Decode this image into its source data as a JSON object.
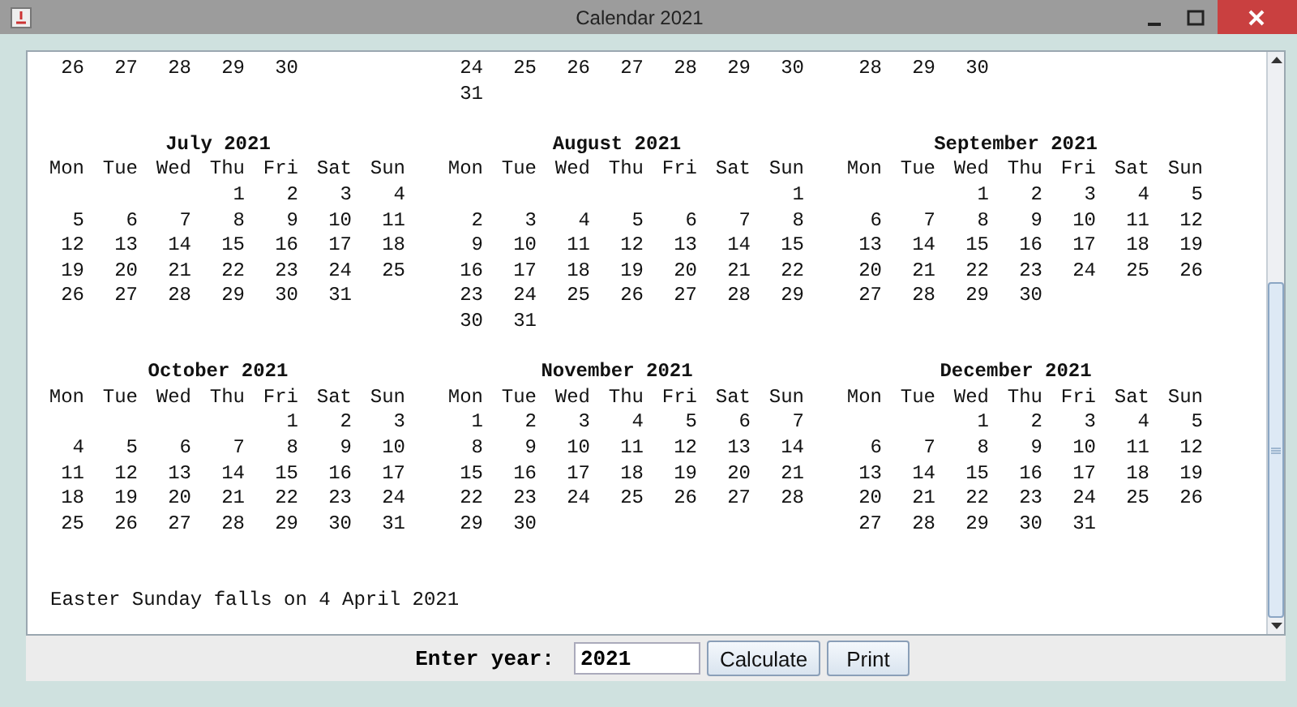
{
  "window": {
    "title": "Calendar 2021"
  },
  "partial_months": [
    {
      "weeks": [
        [
          "26",
          "27",
          "28",
          "29",
          "30"
        ]
      ]
    },
    {
      "weeks": [
        [
          "24",
          "25",
          "26",
          "27",
          "28",
          "29",
          "30"
        ],
        [
          "31"
        ]
      ]
    },
    {
      "weeks": [
        [
          "28",
          "29",
          "30"
        ]
      ]
    }
  ],
  "months": [
    {
      "title": "July 2021",
      "weekdays": [
        "Mon",
        "Tue",
        "Wed",
        "Thu",
        "Fri",
        "Sat",
        "Sun"
      ],
      "weeks": [
        [
          "1",
          "2",
          "3",
          "4"
        ],
        [
          "5",
          "6",
          "7",
          "8",
          "9",
          "10",
          "11"
        ],
        [
          "12",
          "13",
          "14",
          "15",
          "16",
          "17",
          "18"
        ],
        [
          "19",
          "20",
          "21",
          "22",
          "23",
          "24",
          "25"
        ],
        [
          "26",
          "27",
          "28",
          "29",
          "30",
          "31"
        ]
      ]
    },
    {
      "title": "August 2021",
      "weekdays": [
        "Mon",
        "Tue",
        "Wed",
        "Thu",
        "Fri",
        "Sat",
        "Sun"
      ],
      "weeks": [
        [
          "1"
        ],
        [
          "2",
          "3",
          "4",
          "5",
          "6",
          "7",
          "8"
        ],
        [
          "9",
          "10",
          "11",
          "12",
          "13",
          "14",
          "15"
        ],
        [
          "16",
          "17",
          "18",
          "19",
          "20",
          "21",
          "22"
        ],
        [
          "23",
          "24",
          "25",
          "26",
          "27",
          "28",
          "29"
        ],
        [
          "30",
          "31"
        ]
      ]
    },
    {
      "title": "September 2021",
      "weekdays": [
        "Mon",
        "Tue",
        "Wed",
        "Thu",
        "Fri",
        "Sat",
        "Sun"
      ],
      "weeks": [
        [
          "1",
          "2",
          "3",
          "4",
          "5"
        ],
        [
          "6",
          "7",
          "8",
          "9",
          "10",
          "11",
          "12"
        ],
        [
          "13",
          "14",
          "15",
          "16",
          "17",
          "18",
          "19"
        ],
        [
          "20",
          "21",
          "22",
          "23",
          "24",
          "25",
          "26"
        ],
        [
          "27",
          "28",
          "29",
          "30"
        ]
      ]
    },
    {
      "title": "October 2021",
      "weekdays": [
        "Mon",
        "Tue",
        "Wed",
        "Thu",
        "Fri",
        "Sat",
        "Sun"
      ],
      "weeks": [
        [
          "1",
          "2",
          "3"
        ],
        [
          "4",
          "5",
          "6",
          "7",
          "8",
          "9",
          "10"
        ],
        [
          "11",
          "12",
          "13",
          "14",
          "15",
          "16",
          "17"
        ],
        [
          "18",
          "19",
          "20",
          "21",
          "22",
          "23",
          "24"
        ],
        [
          "25",
          "26",
          "27",
          "28",
          "29",
          "30",
          "31"
        ]
      ]
    },
    {
      "title": "November 2021",
      "weekdays": [
        "Mon",
        "Tue",
        "Wed",
        "Thu",
        "Fri",
        "Sat",
        "Sun"
      ],
      "weeks": [
        [
          "1",
          "2",
          "3",
          "4",
          "5",
          "6",
          "7"
        ],
        [
          "8",
          "9",
          "10",
          "11",
          "12",
          "13",
          "14"
        ],
        [
          "15",
          "16",
          "17",
          "18",
          "19",
          "20",
          "21"
        ],
        [
          "22",
          "23",
          "24",
          "25",
          "26",
          "27",
          "28"
        ],
        [
          "29",
          "30"
        ]
      ]
    },
    {
      "title": "December 2021",
      "weekdays": [
        "Mon",
        "Tue",
        "Wed",
        "Thu",
        "Fri",
        "Sat",
        "Sun"
      ],
      "weeks": [
        [
          "1",
          "2",
          "3",
          "4",
          "5"
        ],
        [
          "6",
          "7",
          "8",
          "9",
          "10",
          "11",
          "12"
        ],
        [
          "13",
          "14",
          "15",
          "16",
          "17",
          "18",
          "19"
        ],
        [
          "20",
          "21",
          "22",
          "23",
          "24",
          "25",
          "26"
        ],
        [
          "27",
          "28",
          "29",
          "30",
          "31"
        ]
      ]
    }
  ],
  "easter_note": "Easter Sunday falls on 4 April 2021",
  "controls": {
    "label": "Enter year:",
    "year_value": "2021",
    "buttons": [
      "Calculate",
      "Print"
    ]
  }
}
